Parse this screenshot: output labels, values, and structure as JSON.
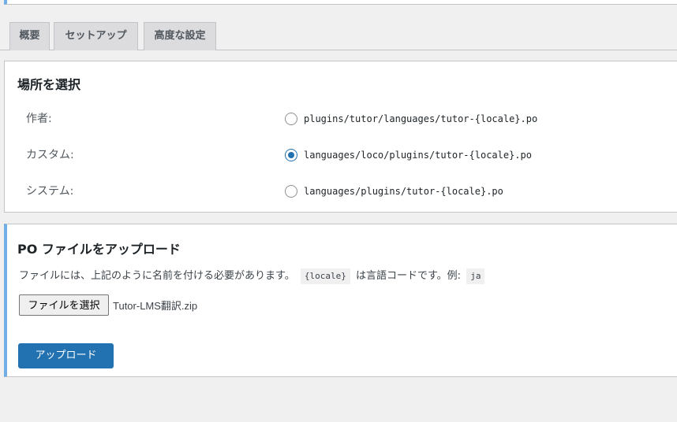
{
  "tabs": [
    {
      "label": "概要"
    },
    {
      "label": "セットアップ"
    },
    {
      "label": "高度な設定"
    }
  ],
  "locations": {
    "title": "場所を選択",
    "options": [
      {
        "label": "作者:",
        "path": "plugins/tutor/languages/tutor-{locale}.po",
        "checked": false
      },
      {
        "label": "カスタム:",
        "path": "languages/loco/plugins/tutor-{locale}.po",
        "checked": true
      },
      {
        "label": "システム:",
        "path": "languages/plugins/tutor-{locale}.po",
        "checked": false
      }
    ]
  },
  "upload": {
    "title": "PO ファイルをアップロード",
    "desc_pre": "ファイルには、上記のように名前を付ける必要があります。",
    "desc_code": "{locale}",
    "desc_mid": "は言語コードです。例:",
    "desc_example": "ja",
    "file_button": "ファイルを選択",
    "file_name": "Tutor-LMS翻訳.zip",
    "submit_label": "アップロード"
  },
  "colors": {
    "accent": "#2271b1",
    "panel_border_accent": "#72aee6",
    "background": "#f0f0f1"
  }
}
